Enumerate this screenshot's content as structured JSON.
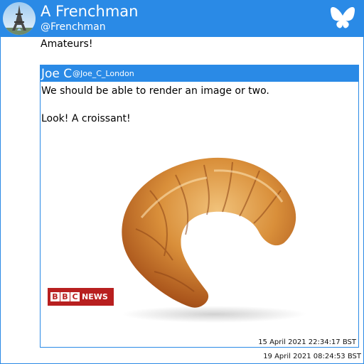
{
  "colors": {
    "accent": "#2a8ae6",
    "bbc_red": "#b81f1f"
  },
  "post": {
    "author": {
      "display_name": "A Frenchman",
      "handle": "@Frenchman",
      "avatar_icon": "eiffel-tower-avatar"
    },
    "service_icon": "bluesky-butterfly-icon",
    "text": "Amateurs!",
    "timestamp": "19 April 2021 08:24:53 BST"
  },
  "quote": {
    "author": {
      "display_name": "Joe C",
      "handle": "@Joe_C_London"
    },
    "text_line1": "We should be able to render an image or two.",
    "text_line2": "Look! A croissant!",
    "image": {
      "subject": "croissant",
      "badge": {
        "letters": [
          "B",
          "B",
          "C"
        ],
        "label": "NEWS"
      }
    },
    "timestamp": "15 April 2021 22:34:17 BST"
  }
}
